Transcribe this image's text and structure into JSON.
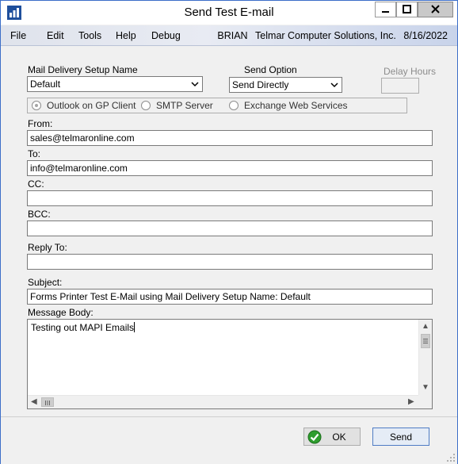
{
  "window": {
    "title": "Send Test E-mail",
    "icons": {
      "app": "bar-chart-icon",
      "minimize": "minimize-icon",
      "maximize": "maximize-icon",
      "close": "close-icon"
    }
  },
  "menu": {
    "items": [
      "File",
      "Edit",
      "Tools",
      "Help",
      "Debug"
    ],
    "user": "BRIAN",
    "company": "Telmar Computer Solutions, Inc.",
    "date": "8/16/2022"
  },
  "form": {
    "mail_setup_label": "Mail Delivery Setup Name",
    "mail_setup_value": "Default",
    "send_option_label": "Send Option",
    "send_option_value": "Send Directly",
    "delay_hours_label": "Delay Hours",
    "delay_hours_value": "",
    "radio_options": [
      {
        "label": "Outlook on GP Client",
        "selected": true
      },
      {
        "label": "SMTP Server",
        "selected": false
      },
      {
        "label": "Exchange Web Services",
        "selected": false
      }
    ],
    "from_label": "From:",
    "from_value": "sales@telmaronline.com",
    "to_label": "To:",
    "to_value": "info@telmaronline.com",
    "cc_label": "CC:",
    "cc_value": "",
    "bcc_label": "BCC:",
    "bcc_value": "",
    "reply_to_label": "Reply To:",
    "reply_to_value": "",
    "subject_label": "Subject:",
    "subject_value": "Forms Printer Test E-Mail using Mail Delivery Setup Name: Default",
    "message_label": "Message Body:",
    "message_value": "Testing out MAPI Emails"
  },
  "buttons": {
    "ok_label": "OK",
    "send_label": "Send"
  },
  "colors": {
    "accent": "#3c6ec8",
    "ok_icon_green": "#2e9d2e"
  }
}
